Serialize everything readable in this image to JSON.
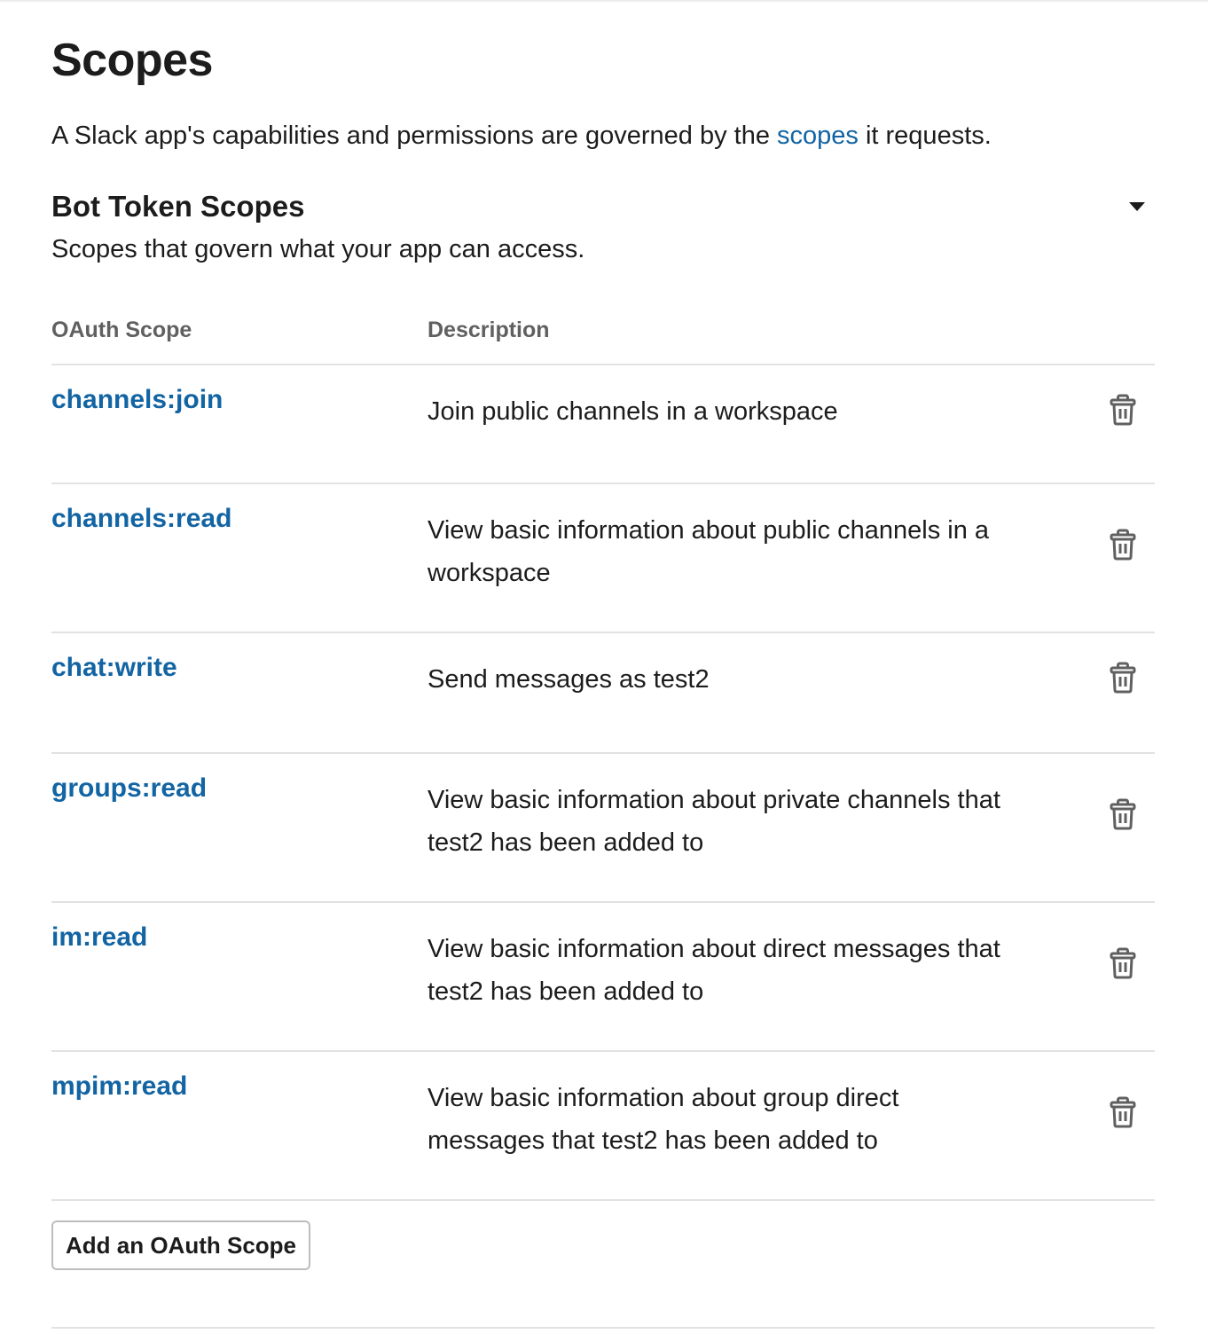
{
  "page": {
    "title": "Scopes",
    "intro_before": "A Slack app's capabilities and permissions are governed by the ",
    "intro_link": "scopes",
    "intro_after": " it requests."
  },
  "bot_token_scopes": {
    "title": "Bot Token Scopes",
    "subtitle": "Scopes that govern what your app can access.",
    "collapse_icon": "caret-down-icon",
    "columns": {
      "scope": "OAuth Scope",
      "description": "Description"
    },
    "rows": [
      {
        "scope": "channels:join",
        "description": "Join public channels in a workspace",
        "action_icon": "trash-icon"
      },
      {
        "scope": "channels:read",
        "description": "View basic information about public channels in a workspace",
        "action_icon": "trash-icon"
      },
      {
        "scope": "chat:write",
        "description": "Send messages as test2",
        "action_icon": "trash-icon"
      },
      {
        "scope": "groups:read",
        "description": "View basic information about private channels that test2 has been added to",
        "action_icon": "trash-icon"
      },
      {
        "scope": "im:read",
        "description": "View basic information about direct messages that test2 has been added to",
        "action_icon": "trash-icon"
      },
      {
        "scope": "mpim:read",
        "description": "View basic information about group direct messages that test2 has been added to",
        "action_icon": "trash-icon"
      }
    ],
    "add_button_label": "Add an OAuth Scope"
  },
  "colors": {
    "link": "#1264a3",
    "text": "#1d1c1d",
    "muted": "#616061",
    "divider": "#e2e2e2"
  }
}
